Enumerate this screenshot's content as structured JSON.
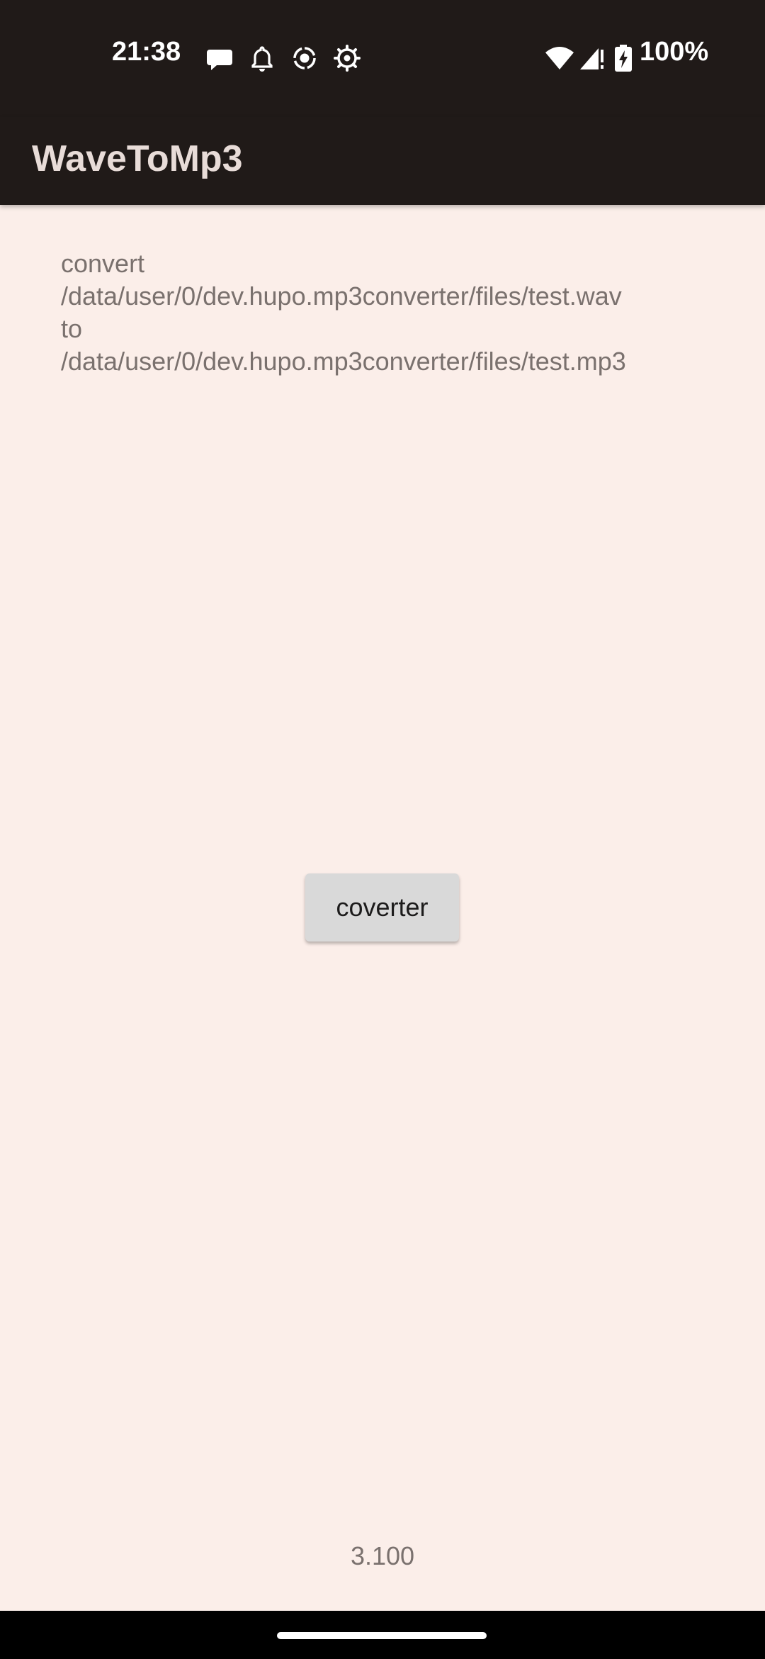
{
  "status_bar": {
    "time": "21:38",
    "battery_text": "100%",
    "icons": [
      "chat-bubble-icon",
      "bell-icon",
      "record-icon",
      "gear-icon",
      "wifi-icon",
      "signal-icon",
      "battery-charging-icon"
    ]
  },
  "app_bar": {
    "title": "WaveToMp3"
  },
  "main": {
    "message_lines": [
      "convert",
      "/data/user/0/dev.hupo.mp3converter/files/test.wav",
      "to",
      "/data/user/0/dev.hupo.mp3converter/files/test.mp3"
    ],
    "button_label": "coverter",
    "version": "3.100"
  },
  "colors": {
    "background": "#fbeee9",
    "bars": "#201a18",
    "text_secondary": "#7a716e",
    "button": "#d9d9d9"
  }
}
